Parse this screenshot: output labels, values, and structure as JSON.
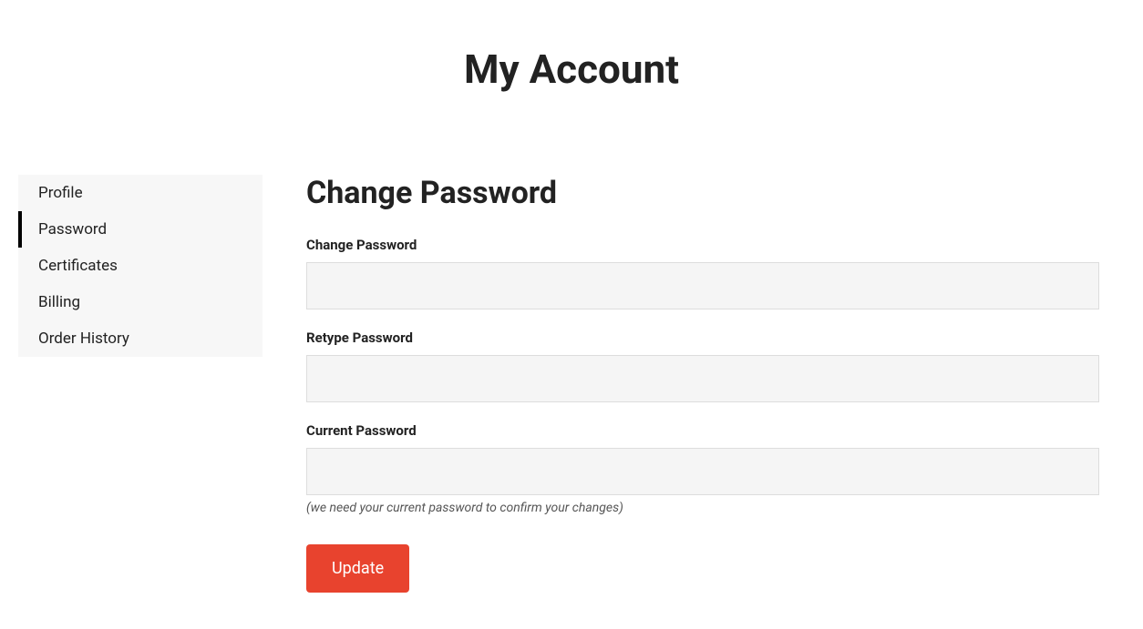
{
  "page": {
    "title": "My Account"
  },
  "sidebar": {
    "items": [
      {
        "label": "Profile",
        "active": false
      },
      {
        "label": "Password",
        "active": true
      },
      {
        "label": "Certificates",
        "active": false
      },
      {
        "label": "Billing",
        "active": false
      },
      {
        "label": "Order History",
        "active": false
      }
    ]
  },
  "main": {
    "section_title": "Change Password",
    "fields": {
      "new_password": {
        "label": "Change Password",
        "value": ""
      },
      "retype_password": {
        "label": "Retype Password",
        "value": ""
      },
      "current_password": {
        "label": "Current Password",
        "value": "",
        "hint": "(we need your current password to confirm your changes)"
      }
    },
    "submit_label": "Update"
  }
}
